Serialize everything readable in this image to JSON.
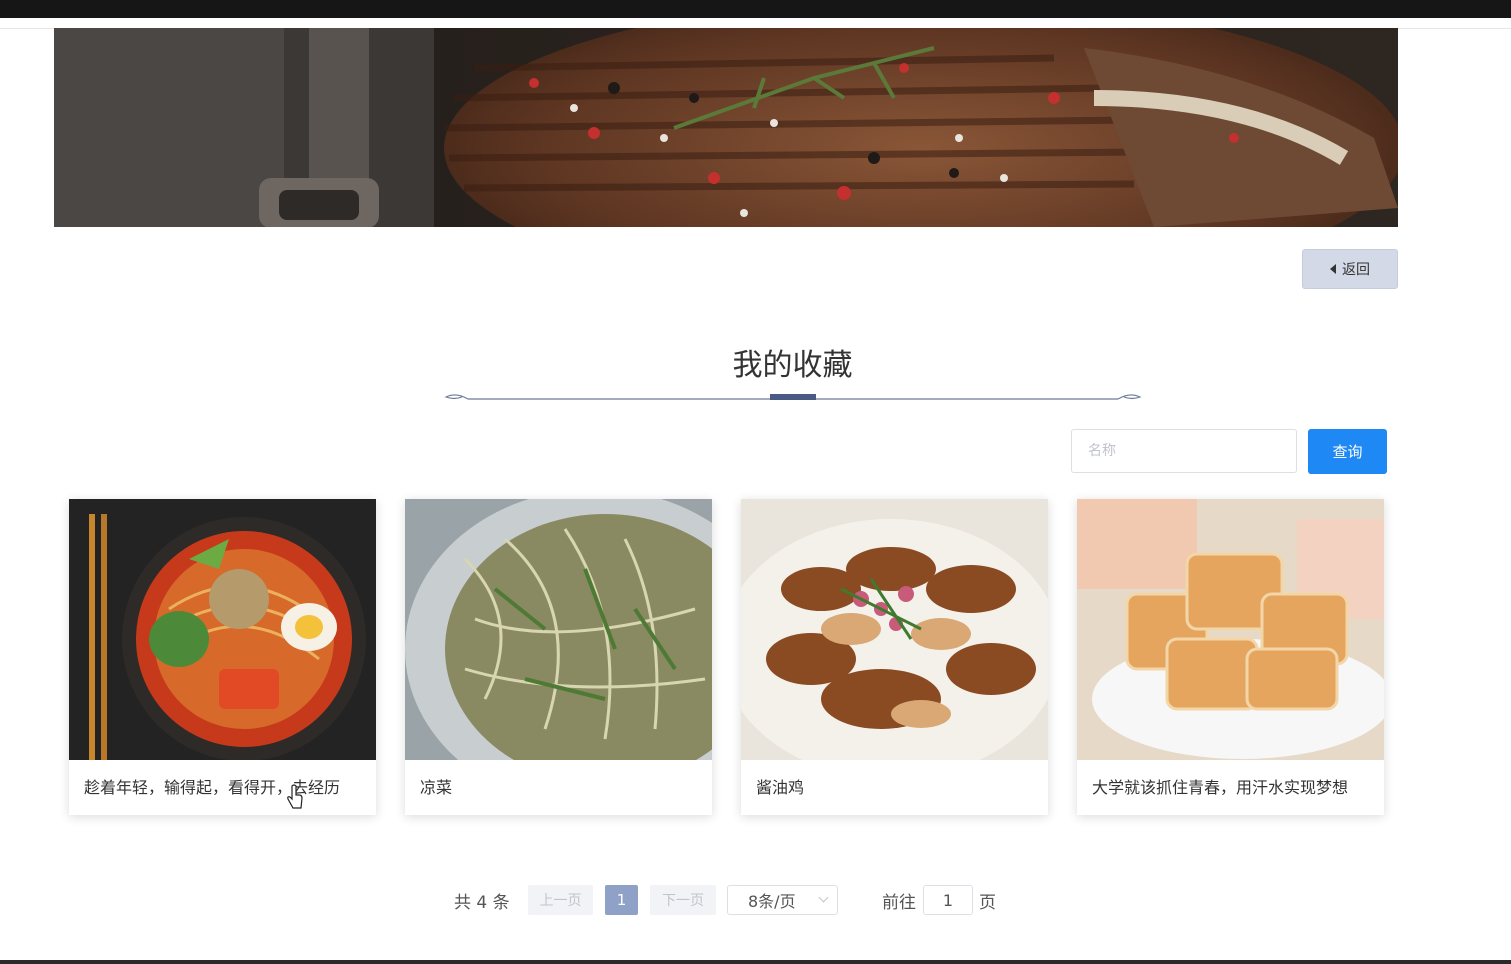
{
  "banner": {
    "alt": "grilled steak banner"
  },
  "back_button": {
    "label": "返回",
    "icon": "caret-left-icon"
  },
  "section": {
    "title": "我的收藏"
  },
  "search": {
    "placeholder": "名称",
    "button_label": "查询"
  },
  "cards": [
    {
      "title": "趁着年轻，输得起，看得开，去经历",
      "image": "cold-noodles-bowl"
    },
    {
      "title": "凉菜",
      "image": "shredded-cold-dish"
    },
    {
      "title": "酱油鸡",
      "image": "soy-sauce-chicken"
    },
    {
      "title": "大学就该抓住青春，用汗水实现梦想",
      "image": "candied-sweets-bowl"
    }
  ],
  "pagination": {
    "total_text": "共 4 条",
    "prev_label": "上一页",
    "current_page": "1",
    "next_label": "下一页",
    "page_size": "8条/页",
    "goto_prefix": "前往",
    "goto_value": "1",
    "goto_suffix": "页"
  },
  "colors": {
    "accent": "#1e88f5",
    "active_page": "#8fa1c7",
    "back_bg": "#d3d9e6",
    "title_line": "#4a5a85"
  }
}
